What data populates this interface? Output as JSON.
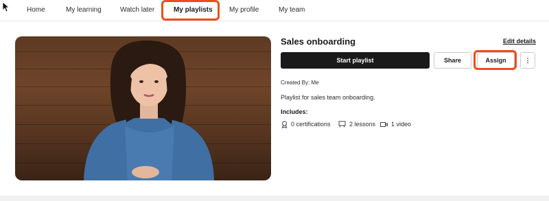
{
  "nav": {
    "tabs": [
      {
        "label": "Home"
      },
      {
        "label": "My learning"
      },
      {
        "label": "Watch later"
      },
      {
        "label": "My playlists"
      },
      {
        "label": "My profile"
      },
      {
        "label": "My team"
      }
    ],
    "active_tab": "My playlists"
  },
  "highlight_color": "#ef4b1d",
  "playlist": {
    "title": "Sales onboarding",
    "edit_label": "Edit details",
    "start_label": "Start playlist",
    "share_label": "Share",
    "assign_label": "Assign",
    "more_label": "⋮",
    "created_by": "Created By: Me",
    "description": "Playlist for sales team onboarding.",
    "includes_label": "Includes:",
    "includes": [
      {
        "icon": "certificate-icon",
        "text": "0 certifications"
      },
      {
        "icon": "lesson-icon",
        "text": "2 lessons"
      },
      {
        "icon": "video-icon",
        "text": "1 video"
      }
    ]
  },
  "colors": {
    "primary_button": "#1a1a1a",
    "video_background": "#6f4529"
  }
}
